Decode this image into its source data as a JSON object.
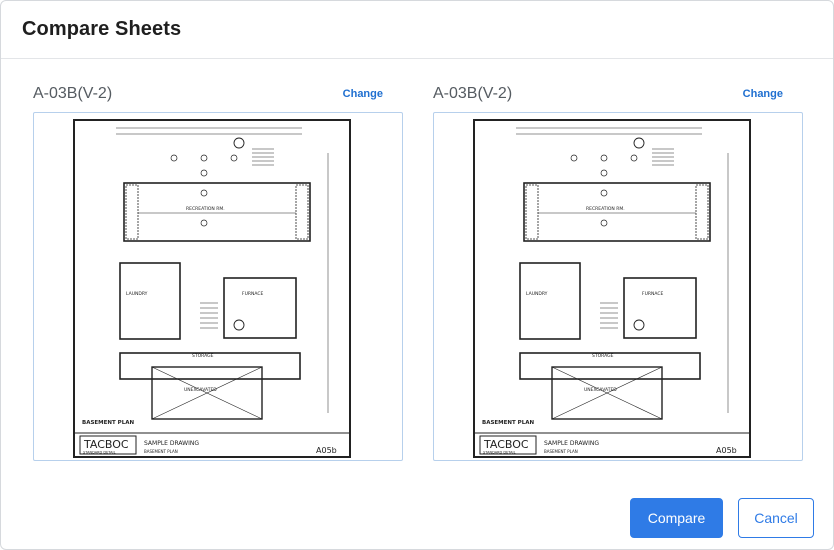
{
  "dialog": {
    "title": "Compare Sheets",
    "compare_label": "Compare",
    "cancel_label": "Cancel"
  },
  "sheets": [
    {
      "name": "A-03B(V-2)",
      "change_label": "Change",
      "drawing": {
        "plan_title": "BASEMENT PLAN",
        "logo": "TACBOC",
        "logo_sub": "STANDARD DETAIL",
        "sheet_title": "SAMPLE DRAWING",
        "sheet_sub": "BASEMENT PLAN",
        "sheet_number": "A05b",
        "rooms": [
          "RECREATION RM.",
          "LAUNDRY",
          "FURNACE",
          "STORAGE",
          "UNEXCAVATED"
        ]
      }
    },
    {
      "name": "A-03B(V-2)",
      "change_label": "Change",
      "drawing": {
        "plan_title": "BASEMENT PLAN",
        "logo": "TACBOC",
        "logo_sub": "STANDARD DETAIL",
        "sheet_title": "SAMPLE DRAWING",
        "sheet_sub": "BASEMENT PLAN",
        "sheet_number": "A05b",
        "rooms": [
          "RECREATION RM.",
          "LAUNDRY",
          "FURNACE",
          "STORAGE",
          "UNEXCAVATED"
        ]
      }
    }
  ],
  "colors": {
    "accent": "#2f7be6",
    "link": "#1f6fd0",
    "thumb_border": "#b7d0ec"
  }
}
